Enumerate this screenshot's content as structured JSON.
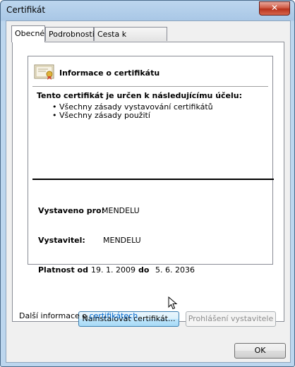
{
  "window": {
    "title": "Certifikát",
    "close_label": "✕"
  },
  "tabs": [
    {
      "label": "Obecné",
      "active": true
    },
    {
      "label": "Podrobnosti",
      "active": false
    },
    {
      "label": "Cesta k certifikátu",
      "active": false
    }
  ],
  "info": {
    "heading": "Informace o certifikátu",
    "purpose_heading": "Tento certifikát je určen k následujícímu účelu:",
    "purposes": [
      "Všechny zásady vystavování certifikátů",
      "Všechny zásady použití"
    ],
    "issued_to_label": "Vystaveno pro:",
    "issued_to_value": "MENDELU",
    "issuer_label": "Vystavitel:",
    "issuer_value": "MENDELU",
    "validity_label": "Platnost od",
    "valid_from": "19. 1. 2009",
    "validity_to_label": "do",
    "valid_to": "5. 6. 2036"
  },
  "buttons": {
    "install": "Nainstalovat certifikát...",
    "issuer_statement": "Prohlášení vystavitele",
    "ok": "OK"
  },
  "more_info": {
    "text": "Další informace o ",
    "link": "certifikátech"
  }
}
